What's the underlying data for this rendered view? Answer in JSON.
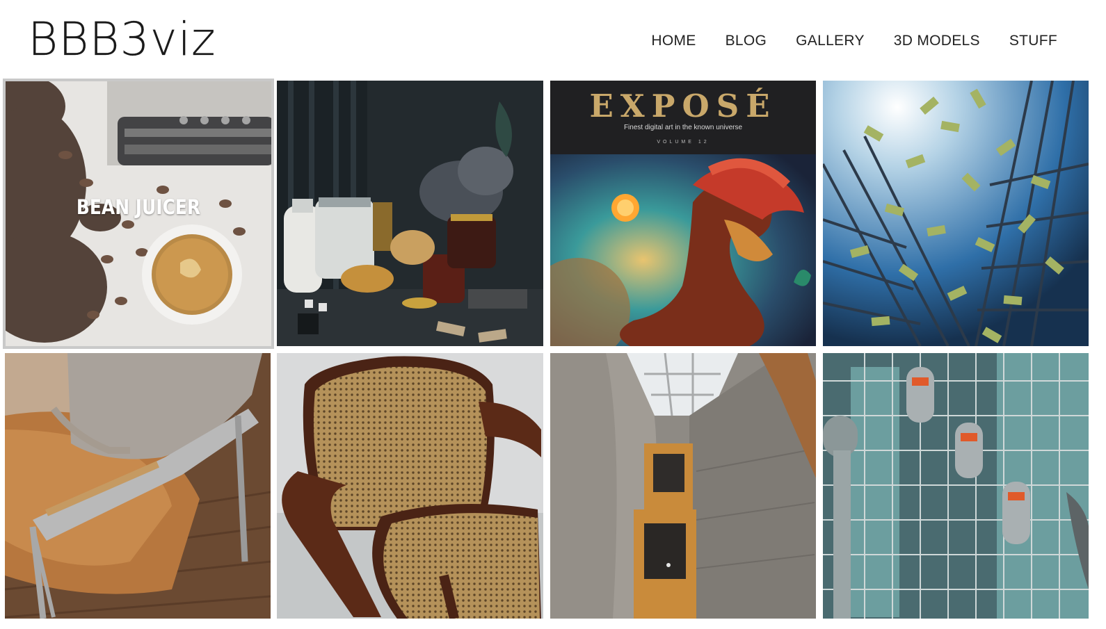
{
  "site": {
    "logo": "BBB3viz"
  },
  "nav": {
    "items": [
      {
        "label": "HOME"
      },
      {
        "label": "BLOG"
      },
      {
        "label": "GALLERY"
      },
      {
        "label": "3D MODELS"
      },
      {
        "label": "STUFF"
      }
    ]
  },
  "gallery": {
    "tiles": [
      {
        "name": "bean-juicer",
        "label": "BEAN JUICER"
      },
      {
        "name": "still-life-jars"
      },
      {
        "name": "expose-cover",
        "cover_title": "EXPOSÉ",
        "cover_subtitle": "Finest digital art in the known universe",
        "cover_volume": "VOLUME 12"
      },
      {
        "name": "money-rain"
      },
      {
        "name": "leather-chair"
      },
      {
        "name": "cane-chair"
      },
      {
        "name": "concrete-atrium"
      },
      {
        "name": "glass-elevators"
      }
    ]
  },
  "colors": {
    "text": "#222222",
    "hover_border": "#c9c9c9"
  }
}
